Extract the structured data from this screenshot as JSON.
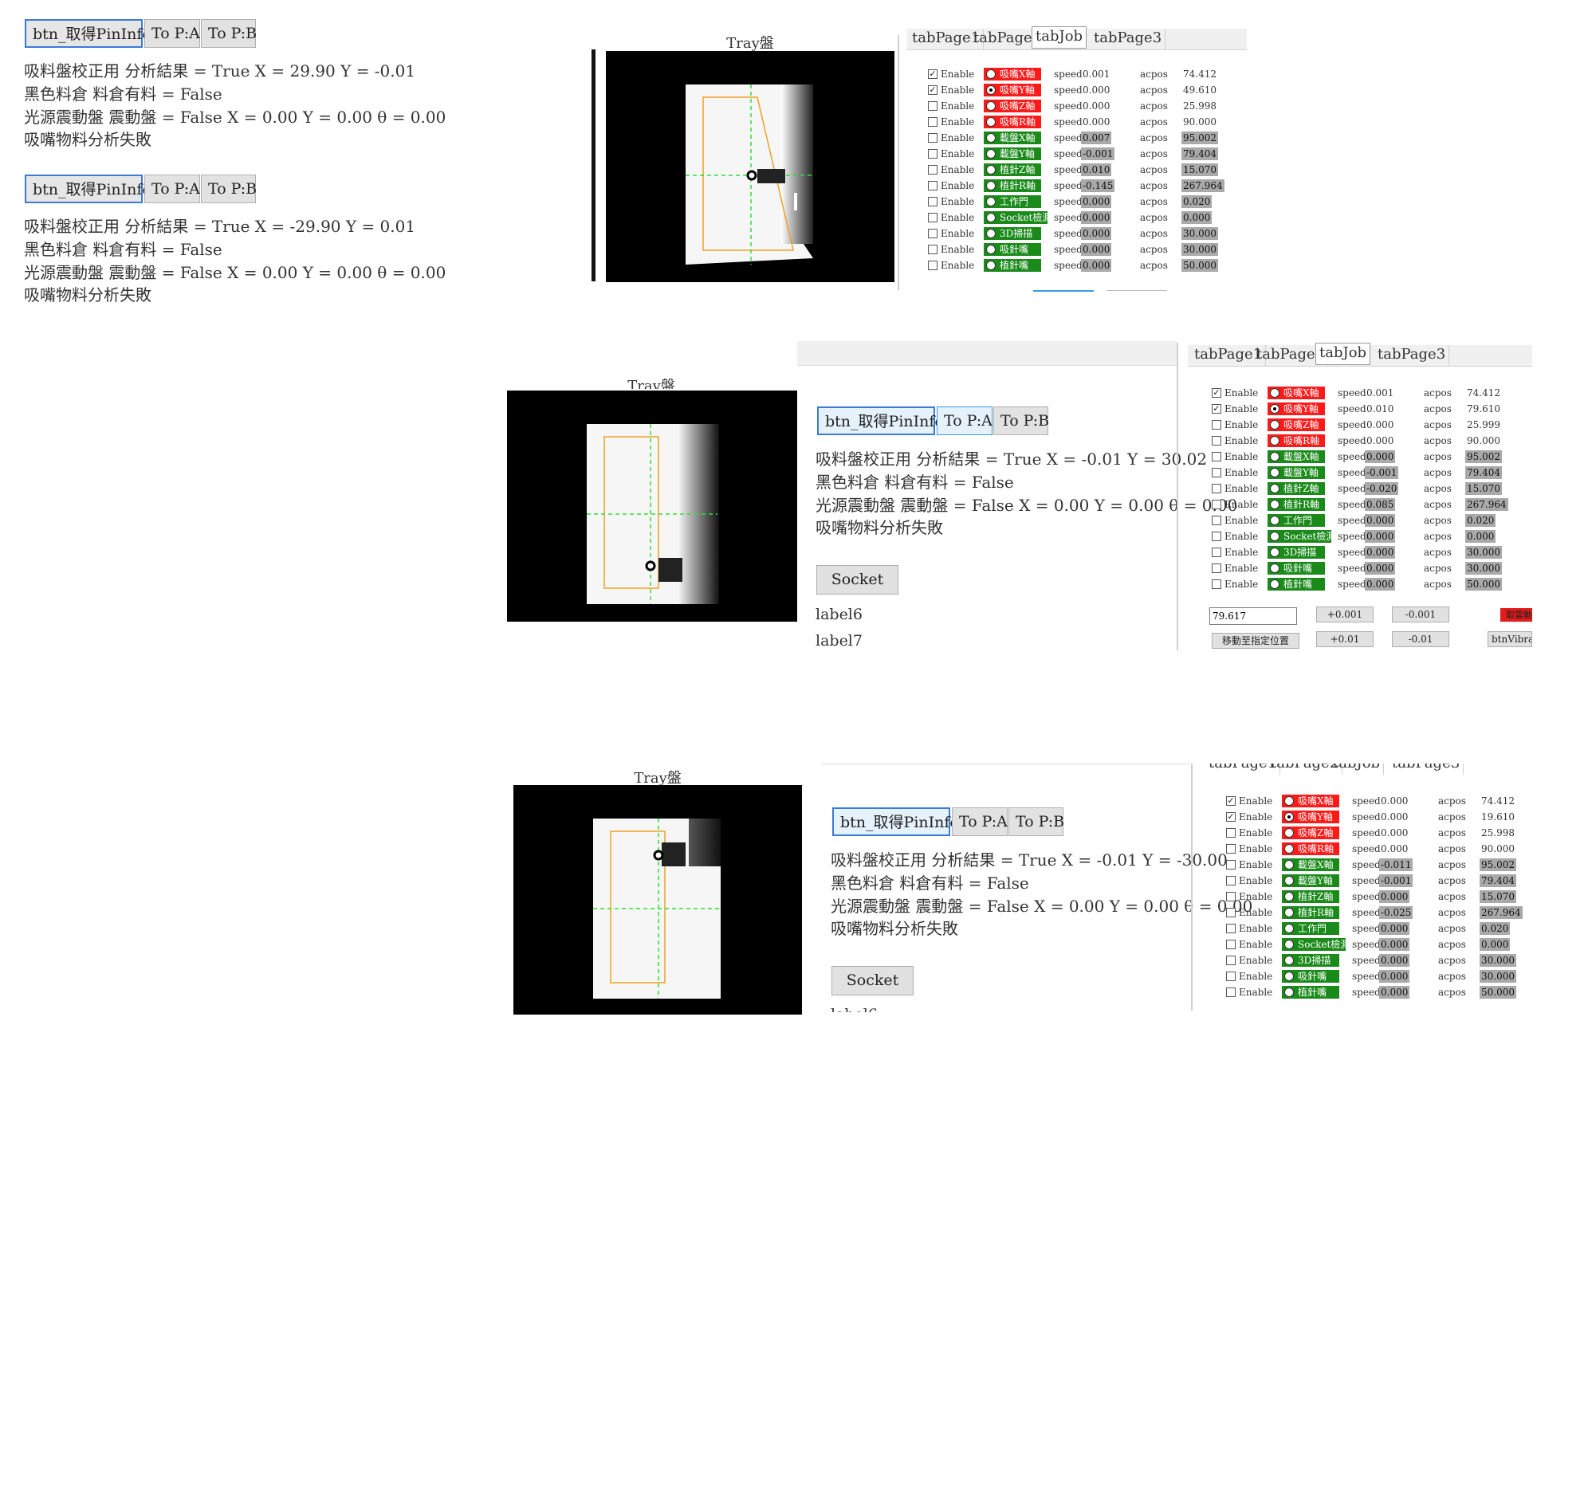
{
  "buttons": {
    "get_pin": "btn_取得PinInfo",
    "to_a": "To P:A",
    "to_b": "To P:B",
    "socket": "Socket",
    "move": "移動至指定位置",
    "vibra": "btnVibra"
  },
  "left_block_1": [
    "吸料盤校正用 分析結果 = True X = 29.90 Y = -0.01",
    "黑色料倉 料倉有料 = False",
    "光源震動盤 震動盤 = False X = 0.00 Y = 0.00 θ = 0.00",
    "吸嘴物料分析失敗"
  ],
  "left_block_2": [
    "吸料盤校正用 分析結果 = True X = -29.90 Y = 0.01",
    "黑色料倉 料倉有料 = False",
    "光源震動盤 震動盤 = False X = 0.00 Y = 0.00 θ = 0.00",
    "吸嘴物料分析失敗"
  ],
  "mid_block": [
    "吸料盤校正用 分析結果 = True X = -0.01 Y = 30.02",
    "黑色料倉 料倉有料 = False",
    "光源震動盤 震動盤 = False X = 0.00 Y = 0.00 θ = 0.00",
    "吸嘴物料分析失敗"
  ],
  "bottom_block": [
    "吸料盤校正用 分析結果 = True X = -0.01 Y = -30.00",
    "黑色料倉 料倉有料 = False",
    "光源震動盤 震動盤 = False X = 0.00 Y = 0.00 θ = 0.00",
    "吸嘴物料分析失敗"
  ],
  "labels": {
    "label6": "label6",
    "label7": "label7",
    "label_partial": "label6"
  },
  "camera_title": "Tray盤",
  "tabs": [
    "tabPage1",
    "tabPage2",
    "tabJob",
    "tabPage3"
  ],
  "grid_labels": {
    "enable": "Enable",
    "speed": "speed",
    "acpos": "acpos"
  },
  "axes": [
    {
      "name": "吸嘴X軸",
      "color": "#ff1a1a"
    },
    {
      "name": "吸嘴Y軸",
      "color": "#ff1a1a"
    },
    {
      "name": "吸嘴Z軸",
      "color": "#ff1a1a"
    },
    {
      "name": "吸嘴R軸",
      "color": "#ff1a1a"
    },
    {
      "name": "載盤X軸",
      "color": "#1a8a1a"
    },
    {
      "name": "載盤Y軸",
      "color": "#1a8a1a"
    },
    {
      "name": "植針Z軸",
      "color": "#1a8a1a"
    },
    {
      "name": "植針R軸",
      "color": "#1a8a1a"
    },
    {
      "name": "工作門",
      "color": "#1a8a1a"
    },
    {
      "name": "Socket檢測",
      "color": "#1a8a1a"
    },
    {
      "name": "3D掃描",
      "color": "#1a8a1a"
    },
    {
      "name": "吸針嘴",
      "color": "#1a8a1a"
    },
    {
      "name": "植針嘴",
      "color": "#1a8a1a"
    }
  ],
  "grid1": {
    "checked": [
      true,
      true,
      false,
      false,
      false,
      false,
      false,
      false,
      false,
      false,
      false,
      false,
      false
    ],
    "speed": [
      "0.001",
      "0.000",
      "0.000",
      "0.000",
      "0.007",
      "-0.001",
      "0.010",
      "-0.145",
      "0.000",
      "0.000",
      "0.000",
      "0.000",
      "0.000"
    ],
    "acpos": [
      "74.412",
      "49.610",
      "25.998",
      "90.000",
      "95.002",
      "79.404",
      "15.070",
      "267.964",
      "0.020",
      "0.000",
      "30.000",
      "30.000",
      "50.000"
    ]
  },
  "grid2": {
    "checked": [
      true,
      true,
      false,
      false,
      false,
      false,
      false,
      false,
      false,
      false,
      false,
      false,
      false
    ],
    "speed": [
      "0.001",
      "0.010",
      "0.000",
      "0.000",
      "0.000",
      "-0.001",
      "-0.020",
      "0.085",
      "0.000",
      "0.000",
      "0.000",
      "0.000",
      "0.000"
    ],
    "acpos": [
      "74.412",
      "79.610",
      "25.999",
      "90.000",
      "95.002",
      "79.404",
      "15.070",
      "267.964",
      "0.020",
      "0.000",
      "30.000",
      "30.000",
      "50.000"
    ]
  },
  "grid3": {
    "checked": [
      true,
      true,
      false,
      false,
      false,
      false,
      false,
      false,
      false,
      false,
      false,
      false,
      false
    ],
    "speed": [
      "0.000",
      "0.000",
      "0.000",
      "0.000",
      "-0.011",
      "-0.001",
      "0.000",
      "-0.025",
      "0.000",
      "0.000",
      "0.000",
      "0.000",
      "0.000"
    ],
    "acpos": [
      "74.412",
      "19.610",
      "25.998",
      "90.000",
      "95.002",
      "79.404",
      "15.070",
      "267.964",
      "0.020",
      "0.000",
      "30.000",
      "30.000",
      "50.000"
    ]
  },
  "jog": {
    "input_value": "79.617",
    "plus_001": "+0.001",
    "minus_001": "-0.001",
    "plus_01": "+0.01",
    "minus_01": "-0.01",
    "red_btn": "取震動"
  }
}
